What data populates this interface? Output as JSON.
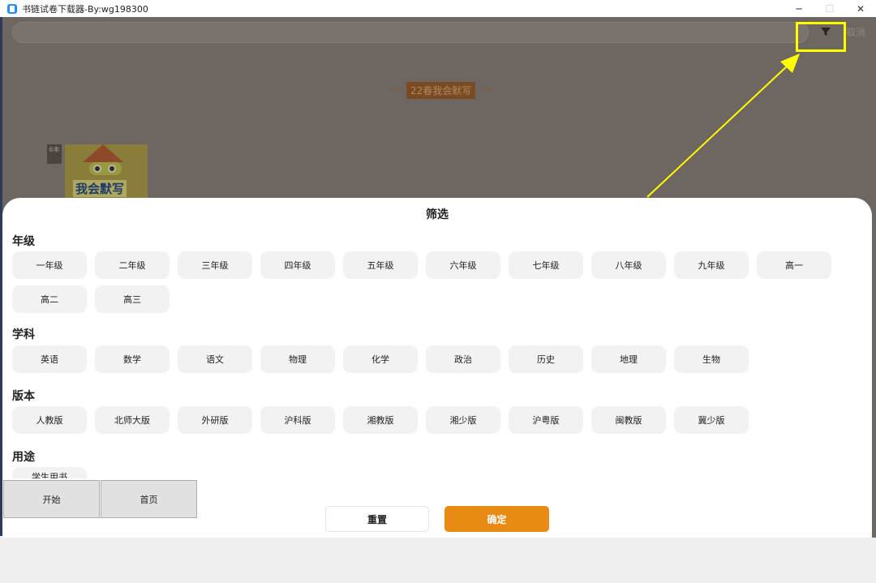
{
  "window": {
    "title": "书链试卷下载器-By:wg198300",
    "minimize": "─",
    "maximize": "☐",
    "close": "✕"
  },
  "header": {
    "cancel_label": "取消",
    "section_title": "22春我会默写"
  },
  "book": {
    "tag": "6本",
    "cover_text": "我会默写"
  },
  "filter": {
    "title": "筛选",
    "groups": [
      {
        "label": "年级",
        "options": [
          "一年级",
          "二年级",
          "三年级",
          "四年级",
          "五年级",
          "六年级",
          "七年级",
          "八年级",
          "九年级",
          "高一",
          "高二",
          "高三"
        ]
      },
      {
        "label": "学科",
        "options": [
          "英语",
          "数学",
          "语文",
          "物理",
          "化学",
          "政治",
          "历史",
          "地理",
          "生物"
        ]
      },
      {
        "label": "版本",
        "options": [
          "人教版",
          "北师大版",
          "外研版",
          "沪科版",
          "湘教版",
          "湘少版",
          "沪粤版",
          "闽教版",
          "冀少版"
        ]
      },
      {
        "label": "用途",
        "options": [
          "学生用书"
        ]
      }
    ],
    "reset_label": "重置",
    "confirm_label": "确定"
  },
  "overlay": {
    "start_label": "开始",
    "home_label": "首页"
  },
  "colors": {
    "accent": "#e78b15",
    "annotation": "#ffff00"
  }
}
